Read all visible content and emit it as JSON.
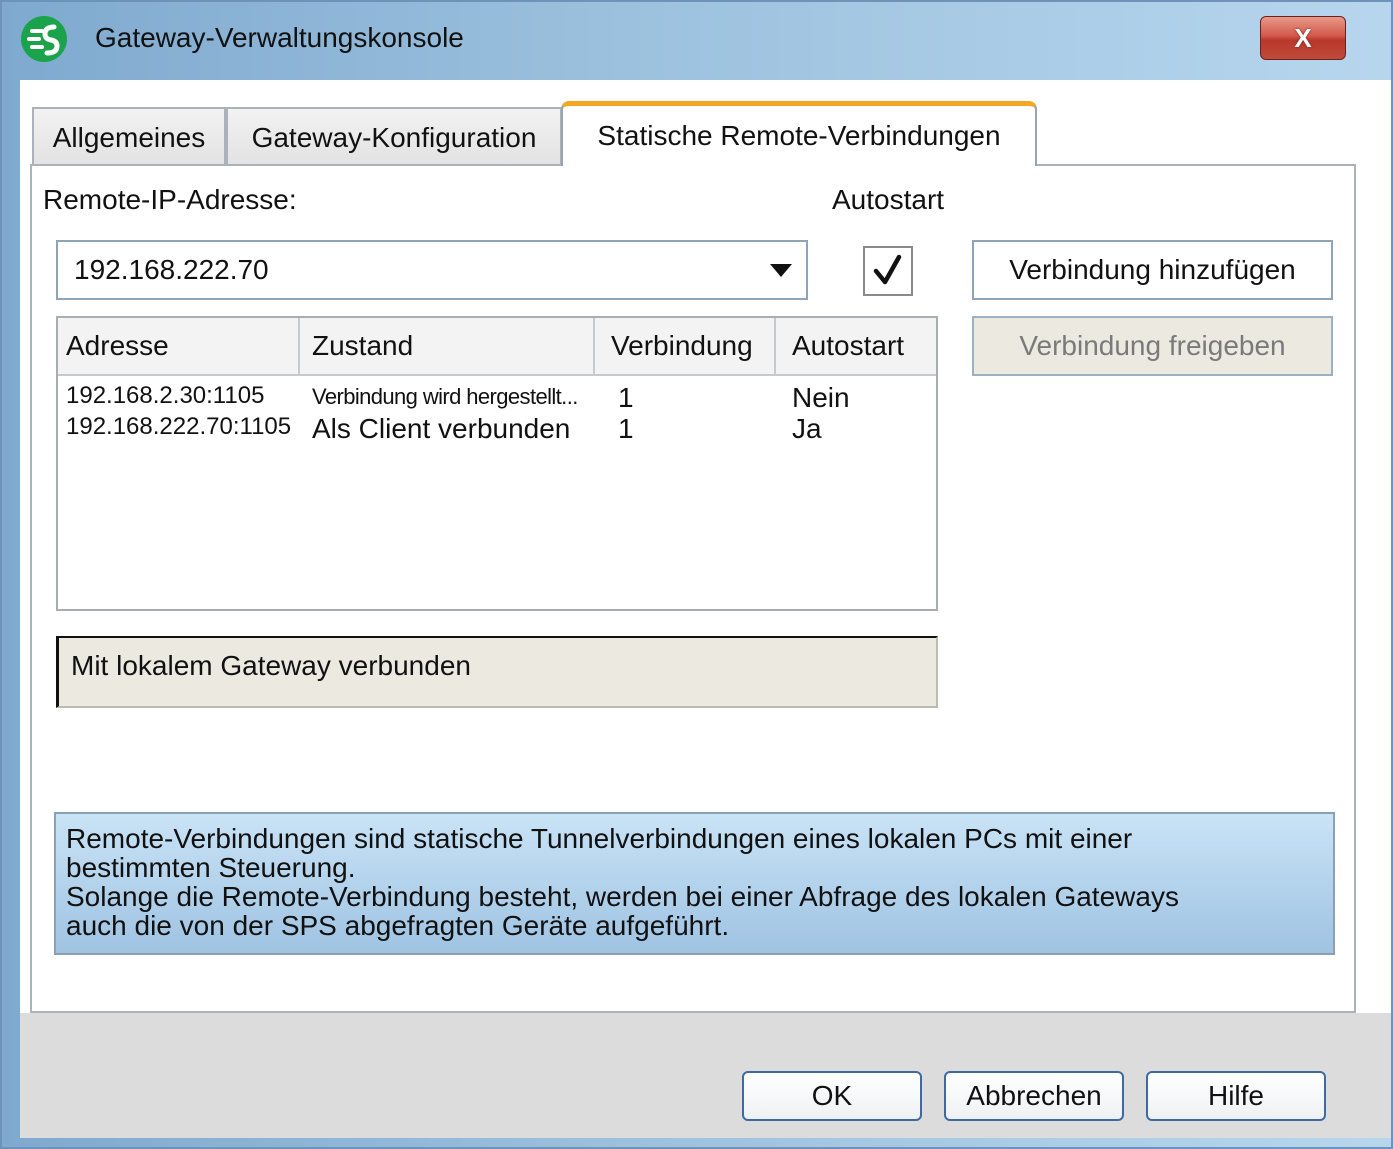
{
  "window": {
    "title": "Gateway-Verwaltungskonsole",
    "close_label": "X"
  },
  "tabs": [
    {
      "label": "Allgemeines",
      "active": false
    },
    {
      "label": "Gateway-Konfiguration",
      "active": false
    },
    {
      "label": "Statische Remote-Verbindungen",
      "active": true
    }
  ],
  "remote": {
    "ip_label": "Remote-IP-Adresse:",
    "ip_value": "192.168.222.70",
    "autostart_label": "Autostart",
    "autostart_checked": true,
    "add_button": "Verbindung hinzufügen",
    "release_button": "Verbindung freigeben"
  },
  "table": {
    "columns": [
      "Adresse",
      "Zustand",
      "Verbindung",
      "Autostart"
    ],
    "rows": [
      {
        "address": "192.168.2.30:1105",
        "state": "Verbindung wird hergestellt...",
        "connection": "1",
        "autostart": "Nein"
      },
      {
        "address": "192.168.222.70:1105",
        "state": "Als Client verbunden",
        "connection": "1",
        "autostart": "Ja"
      }
    ]
  },
  "status": {
    "text": "Mit lokalem Gateway verbunden"
  },
  "info": {
    "lines": [
      "Remote-Verbindungen sind statische Tunnelverbindungen eines lokalen PCs mit einer",
      "bestimmten Steuerung.",
      "Solange die Remote-Verbindung besteht, werden bei einer Abfrage des lokalen Gateways",
      "auch die von der SPS abgefragten Geräte aufgeführt."
    ]
  },
  "footer": {
    "ok": "OK",
    "cancel": "Abbrechen",
    "help": "Hilfe"
  },
  "colors": {
    "active_tab_accent": "#f5a623",
    "logo_green": "#1aa34a",
    "close_red": "#c04a3b"
  }
}
